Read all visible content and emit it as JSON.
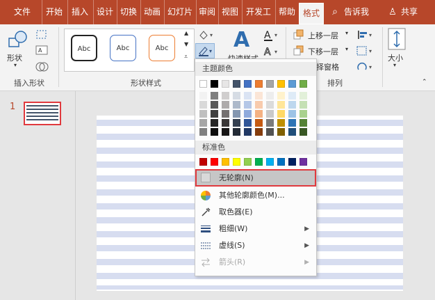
{
  "tabs": [
    {
      "label": "文件"
    },
    {
      "label": "开始"
    },
    {
      "label": "插入"
    },
    {
      "label": "设计"
    },
    {
      "label": "切换"
    },
    {
      "label": "动画"
    },
    {
      "label": "幻灯片"
    },
    {
      "label": "审阅"
    },
    {
      "label": "视图"
    },
    {
      "label": "开发工"
    },
    {
      "label": "帮助"
    },
    {
      "label": "格式"
    }
  ],
  "active_tab": "格式",
  "tell_me": "告诉我",
  "share": "共享",
  "ribbon": {
    "shapes_label": "形状",
    "insert_shapes_group": "插入形状",
    "shape_styles_group": "形状样式",
    "style_sample": "Abc",
    "quick_styles": "快速样式",
    "bring_forward": "上移一层",
    "send_backward": "下移一层",
    "selection_pane": "择窗格",
    "arrange_group": "排列",
    "size_label": "大小"
  },
  "thumb": {
    "number": "1"
  },
  "outline_menu": {
    "theme_colors_header": "主题颜色",
    "standard_colors_header": "标准色",
    "no_outline": "无轮廓(N)",
    "more_colors": "其他轮廓颜色(M)...",
    "eyedropper": "取色器(E)",
    "weight": "粗细(W)",
    "dashes": "虚线(S)",
    "arrows": "箭头(R)"
  },
  "colors": {
    "brand": "#b7472a",
    "highlight": "#e0393e",
    "theme_top": [
      "#ffffff",
      "#000000",
      "#e7e6e6",
      "#44546a",
      "#4472c4",
      "#ed7d31",
      "#a5a5a5",
      "#ffc000",
      "#5b9bd5",
      "#70ad47"
    ],
    "theme_shades": [
      [
        "#f2f2f2",
        "#7f7f7f",
        "#d0cece",
        "#d6dce4",
        "#dae3f3",
        "#fbe5d6",
        "#ededed",
        "#fff2cc",
        "#deebf7",
        "#e2f0d9"
      ],
      [
        "#d9d9d9",
        "#595959",
        "#aeabab",
        "#adb9ca",
        "#b4c7e7",
        "#f8cbad",
        "#dbdbdb",
        "#ffe699",
        "#bdd7ee",
        "#c5e0b4"
      ],
      [
        "#bfbfbf",
        "#404040",
        "#757171",
        "#8497b0",
        "#8faadc",
        "#f4b183",
        "#c9c9c9",
        "#ffd966",
        "#9dc3e6",
        "#a9d18e"
      ],
      [
        "#a6a6a6",
        "#262626",
        "#3b3838",
        "#333f50",
        "#2f5597",
        "#c55a11",
        "#7b7b7b",
        "#bf9000",
        "#2e75b6",
        "#548235"
      ],
      [
        "#808080",
        "#0d0d0d",
        "#171616",
        "#222a35",
        "#203864",
        "#843c0c",
        "#525252",
        "#7f6000",
        "#1f4e79",
        "#385723"
      ]
    ],
    "standard": [
      "#c00000",
      "#ff0000",
      "#ffc000",
      "#ffff00",
      "#92d050",
      "#00b050",
      "#00b0f0",
      "#0070c0",
      "#002060",
      "#7030a0"
    ]
  }
}
